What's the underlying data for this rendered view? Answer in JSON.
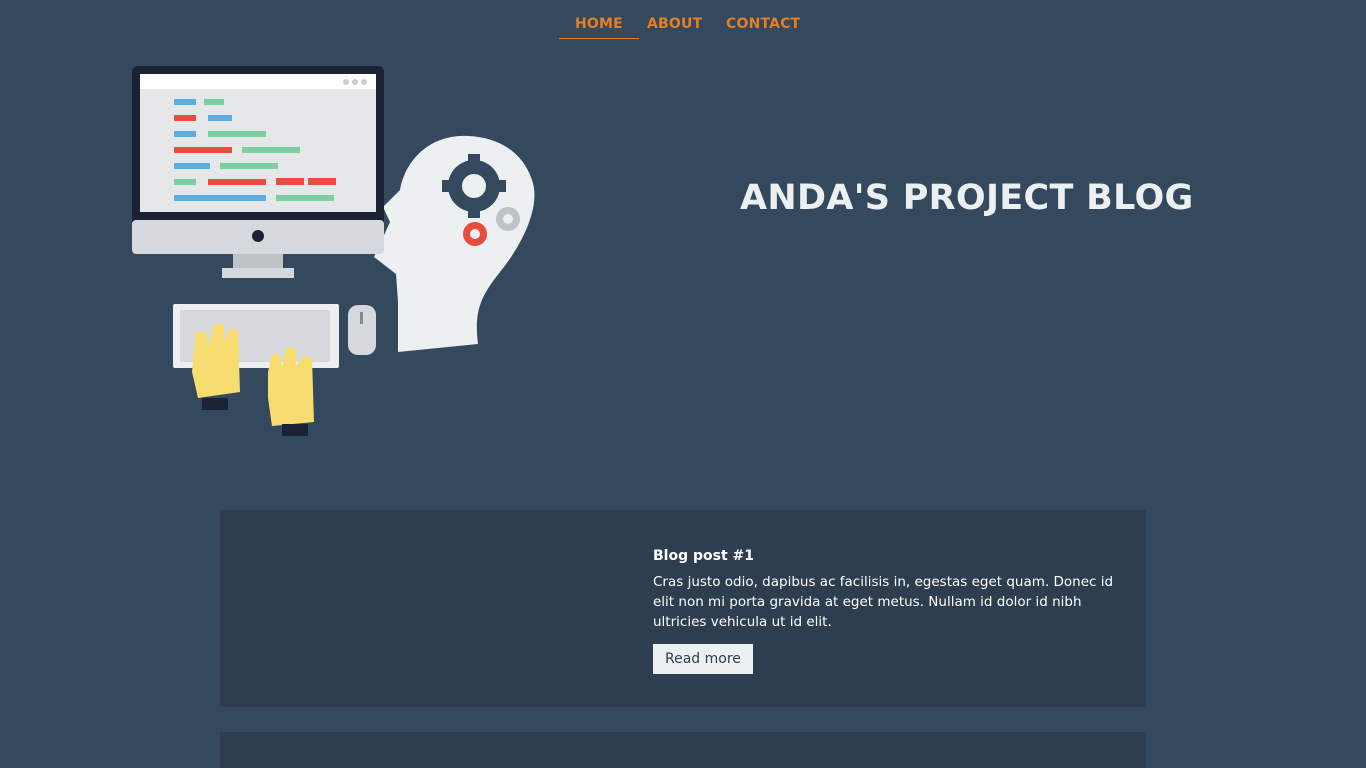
{
  "nav": {
    "items": [
      {
        "label": "HOME",
        "active": true
      },
      {
        "label": "ABOUT",
        "active": false
      },
      {
        "label": "CONTACT",
        "active": false
      }
    ]
  },
  "hero": {
    "title": "ANDA'S PROJECT BLOG",
    "illustration": "developer-thinking-illustration"
  },
  "posts": [
    {
      "title": "Blog post #1",
      "excerpt": "Cras justo odio, dapibus ac facilisis in, egestas eget quam. Donec id elit non mi porta gravida at eget metus. Nullam id dolor id nibh ultricies vehicula ut id elit.",
      "button_label": "Read more"
    }
  ],
  "colors": {
    "background": "#34495e",
    "card": "#2e3e50",
    "accent": "#e67e22",
    "title": "#ecf0f1"
  }
}
